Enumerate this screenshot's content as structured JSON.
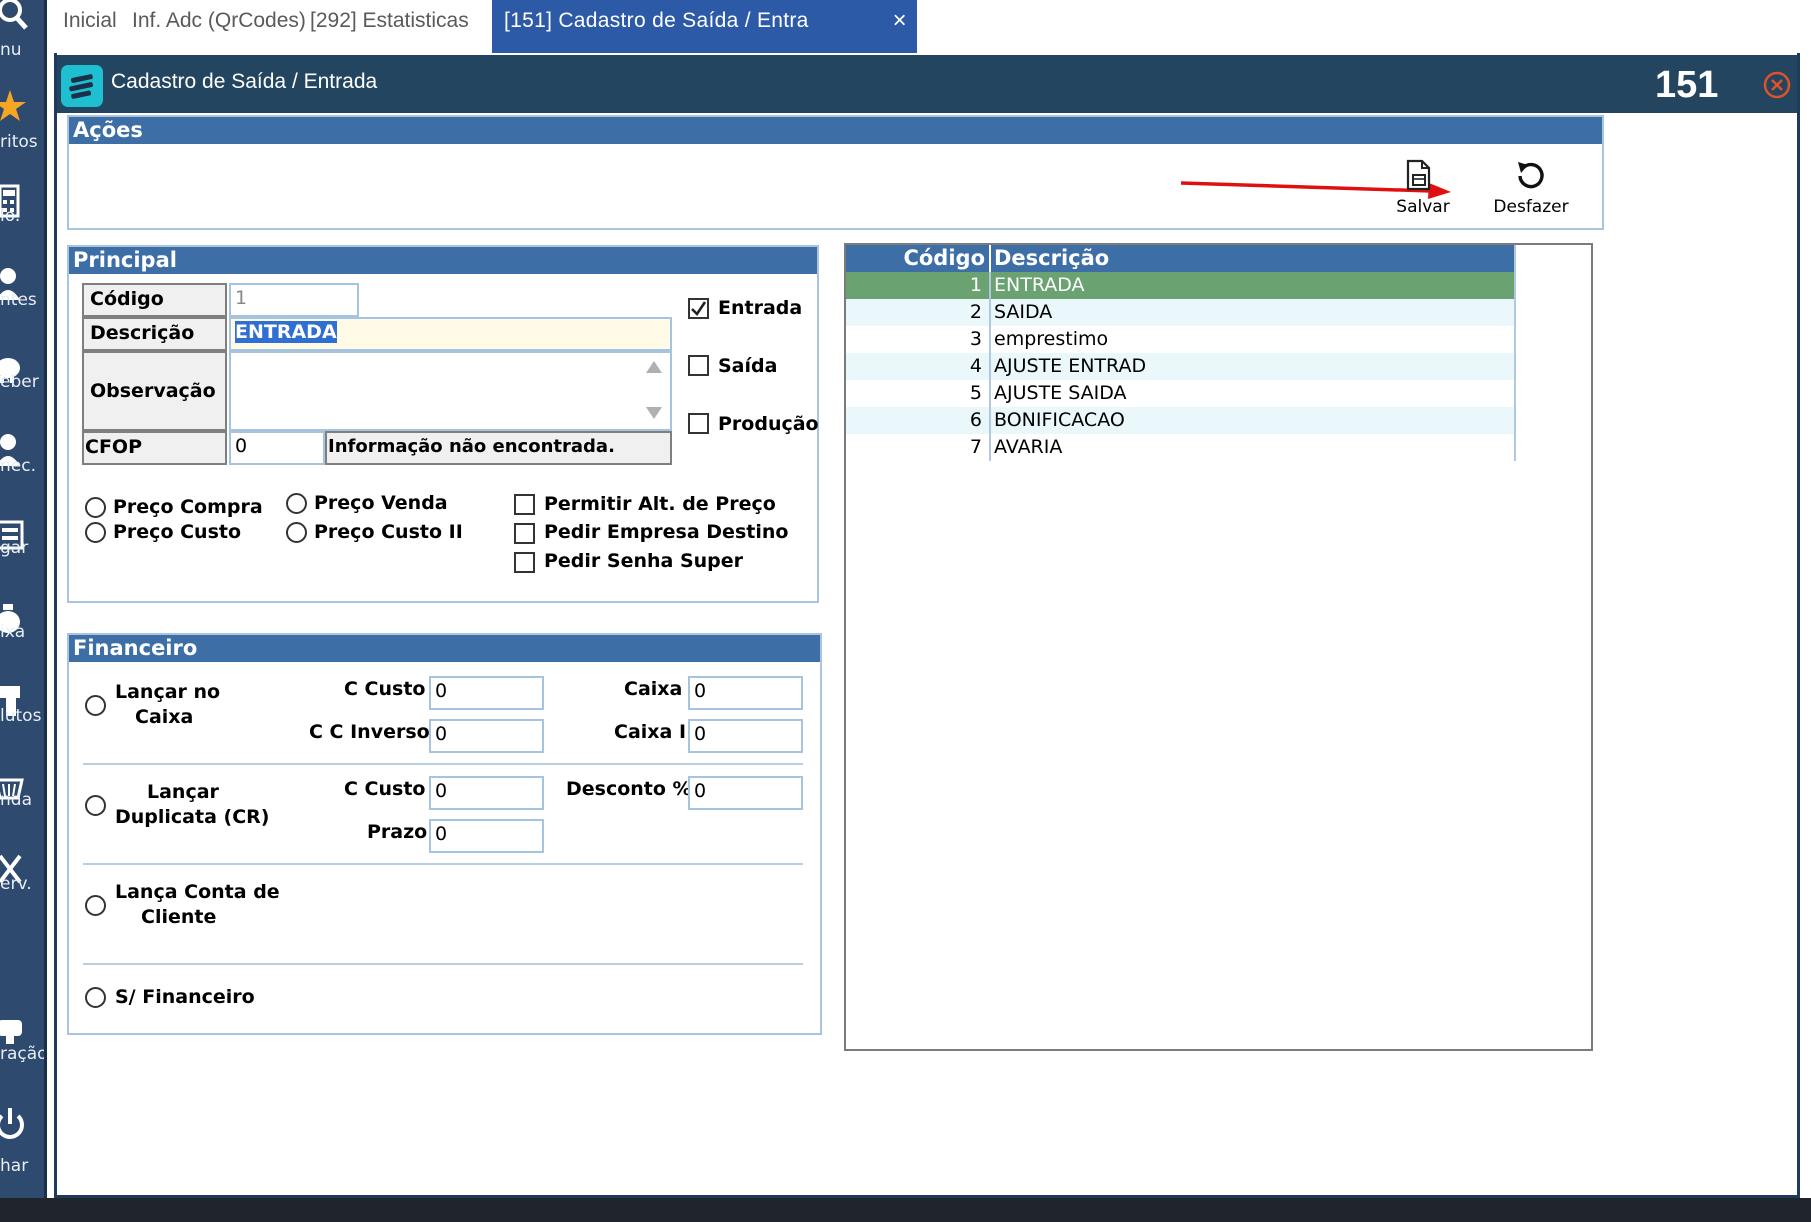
{
  "sidebar": {
    "items": [
      {
        "label": "nu",
        "icon": "search-icon"
      },
      {
        "label": "ritos",
        "icon": "star-icon"
      },
      {
        "label": "lo.",
        "icon": "calculator-icon"
      },
      {
        "label": "ntes",
        "icon": "user-icon"
      },
      {
        "label": "eber",
        "icon": "piggy-bank-icon"
      },
      {
        "label": "nec.",
        "icon": "supplier-icon"
      },
      {
        "label": "gar",
        "icon": "payment-icon"
      },
      {
        "label": "ixa",
        "icon": "money-bag-icon"
      },
      {
        "label": "lutos",
        "icon": "barcode-scanner-icon"
      },
      {
        "label": "nda",
        "icon": "shopping-basket-icon"
      },
      {
        "label": "erv.",
        "icon": "tools-icon"
      },
      {
        "label": "ração",
        "icon": "settings-icon"
      },
      {
        "label": "har",
        "icon": "power-icon"
      }
    ]
  },
  "tabs": [
    {
      "label": "Inicial"
    },
    {
      "label": "Inf. Adc (QrCodes)"
    },
    {
      "label": "[292] Estatisticas"
    },
    {
      "label": "[151] Cadastro de Saída / Entra",
      "active": true,
      "close": "×"
    }
  ],
  "window": {
    "title": "Cadastro de Saída / Entrada",
    "code": "151"
  },
  "acoes": {
    "title": "Ações",
    "salvar": "Salvar",
    "desfazer": "Desfazer"
  },
  "principal": {
    "title": "Principal",
    "codigo_label": "Código",
    "codigo_value": "1",
    "descricao_label": "Descrição",
    "descricao_value": "ENTRADA",
    "observacao_label": "Observação",
    "observacao_value": "",
    "cfop_label": "CFOP",
    "cfop_value": "0",
    "cfop_info": "Informação não encontrada.",
    "entrada": "Entrada",
    "saida": "Saída",
    "producao": "Produção",
    "preco_compra": "Preço Compra",
    "preco_custo": "Preço Custo",
    "preco_venda": "Preço Venda",
    "preco_custo_ii": "Preço Custo II",
    "permitir_alt": "Permitir Alt. de Preço",
    "pedir_empresa": "Pedir Empresa Destino",
    "pedir_senha": "Pedir Senha Super"
  },
  "financeiro": {
    "title": "Financeiro",
    "lancar_caixa_1": "Lançar no",
    "lancar_caixa_2": "Caixa",
    "c_custo_label": "C Custo",
    "c_custo_value": "0",
    "caixa_label": "Caixa",
    "caixa_value": "0",
    "cc_inverso_label": "C C Inverso",
    "cc_inverso_value": "0",
    "caixa_i_label": "Caixa I",
    "caixa_i_value": "0",
    "lancar_dup_1": "Lançar",
    "lancar_dup_2": "Duplicata (CR)",
    "c_custo2_label": "C Custo",
    "c_custo2_value": "0",
    "desconto_label": "Desconto %",
    "desconto_value": "0",
    "prazo_label": "Prazo",
    "prazo_value": "0",
    "lanca_conta_1": "Lança Conta de",
    "lanca_conta_2": "Cliente",
    "sem_financeiro": "S/ Financeiro"
  },
  "grid": {
    "col_codigo": "Código",
    "col_descricao": "Descrição",
    "rows": [
      {
        "codigo": "1",
        "descricao": "ENTRADA"
      },
      {
        "codigo": "2",
        "descricao": "SAIDA"
      },
      {
        "codigo": "3",
        "descricao": "emprestimo"
      },
      {
        "codigo": "4",
        "descricao": "AJUSTE ENTRAD"
      },
      {
        "codigo": "5",
        "descricao": "AJUSTE SAIDA"
      },
      {
        "codigo": "6",
        "descricao": "BONIFICACAO"
      },
      {
        "codigo": "7",
        "descricao": "AVARIA"
      }
    ]
  },
  "colors": {
    "tab_active": "#2d5aa6",
    "title_bar": "#23455f",
    "panel_header": "#3d6fa6",
    "selected_row": "#6aa272",
    "alt_row": "#eaf7fb",
    "arrow": "#e01010"
  }
}
